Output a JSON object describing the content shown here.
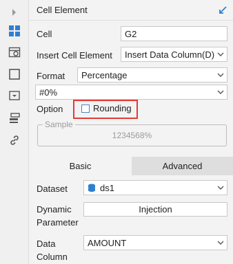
{
  "panel": {
    "title": "Cell Element"
  },
  "rail": {
    "icons": [
      "expand-arrow-icon",
      "cell-element-icon",
      "cell-attribute-icon",
      "cell-border-icon",
      "widget-icon",
      "condition-attribute-icon",
      "hyperlink-icon"
    ],
    "active_color": "#2f7fd1"
  },
  "form": {
    "cell_label": "Cell",
    "cell_value": "G2",
    "insert_label": "Insert Cell Element",
    "insert_value": "Insert Data Column(D)",
    "format_label": "Format",
    "format_value": "Percentage",
    "pattern_value": "#0%",
    "option_label": "Option",
    "rounding_label": "Rounding",
    "rounding_checked": false,
    "sample_legend": "Sample",
    "sample_value": "1234568%"
  },
  "tabs": [
    {
      "label": "Basic",
      "active": true
    },
    {
      "label": "Advanced",
      "active": false
    }
  ],
  "basic": {
    "dataset_label": "Dataset",
    "dataset_value": "ds1",
    "dynamic_label_1": "Dynamic",
    "dynamic_label_2": "Parameter",
    "injection_label": "Injection",
    "data_column_label_1": "Data",
    "data_column_label_2": "Column",
    "data_column_value": "AMOUNT"
  },
  "colors": {
    "highlight": "#e53935",
    "accent": "#2f7fd1",
    "dataset_icon": "#2f7fd1"
  }
}
